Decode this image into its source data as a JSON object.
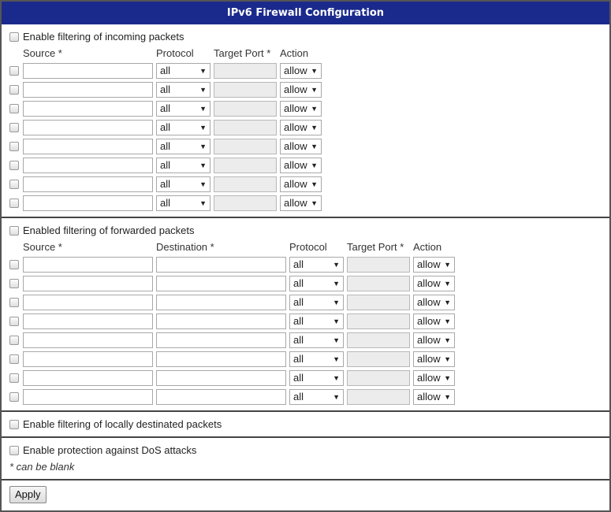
{
  "title": "IPv6 Firewall Configuration",
  "incoming": {
    "enable_label": "Enable filtering of incoming packets",
    "headers": {
      "source": "Source *",
      "protocol": "Protocol",
      "target_port": "Target Port *",
      "action": "Action"
    },
    "rows": [
      {
        "source": "",
        "protocol": "all",
        "target_port": "",
        "action": "allow"
      },
      {
        "source": "",
        "protocol": "all",
        "target_port": "",
        "action": "allow"
      },
      {
        "source": "",
        "protocol": "all",
        "target_port": "",
        "action": "allow"
      },
      {
        "source": "",
        "protocol": "all",
        "target_port": "",
        "action": "allow"
      },
      {
        "source": "",
        "protocol": "all",
        "target_port": "",
        "action": "allow"
      },
      {
        "source": "",
        "protocol": "all",
        "target_port": "",
        "action": "allow"
      },
      {
        "source": "",
        "protocol": "all",
        "target_port": "",
        "action": "allow"
      },
      {
        "source": "",
        "protocol": "all",
        "target_port": "",
        "action": "allow"
      }
    ]
  },
  "forwarded": {
    "enable_label": "Enabled filtering of forwarded packets",
    "headers": {
      "source": "Source *",
      "destination": "Destination *",
      "protocol": "Protocol",
      "target_port": "Target Port *",
      "action": "Action"
    },
    "rows": [
      {
        "source": "",
        "destination": "",
        "protocol": "all",
        "target_port": "",
        "action": "allow"
      },
      {
        "source": "",
        "destination": "",
        "protocol": "all",
        "target_port": "",
        "action": "allow"
      },
      {
        "source": "",
        "destination": "",
        "protocol": "all",
        "target_port": "",
        "action": "allow"
      },
      {
        "source": "",
        "destination": "",
        "protocol": "all",
        "target_port": "",
        "action": "allow"
      },
      {
        "source": "",
        "destination": "",
        "protocol": "all",
        "target_port": "",
        "action": "allow"
      },
      {
        "source": "",
        "destination": "",
        "protocol": "all",
        "target_port": "",
        "action": "allow"
      },
      {
        "source": "",
        "destination": "",
        "protocol": "all",
        "target_port": "",
        "action": "allow"
      },
      {
        "source": "",
        "destination": "",
        "protocol": "all",
        "target_port": "",
        "action": "allow"
      }
    ]
  },
  "local": {
    "enable_label": "Enable filtering of locally destinated packets"
  },
  "dos": {
    "enable_label": "Enable protection against DoS attacks"
  },
  "note": "* can be blank",
  "apply_label": "Apply",
  "dropdown_arrow": "▼"
}
